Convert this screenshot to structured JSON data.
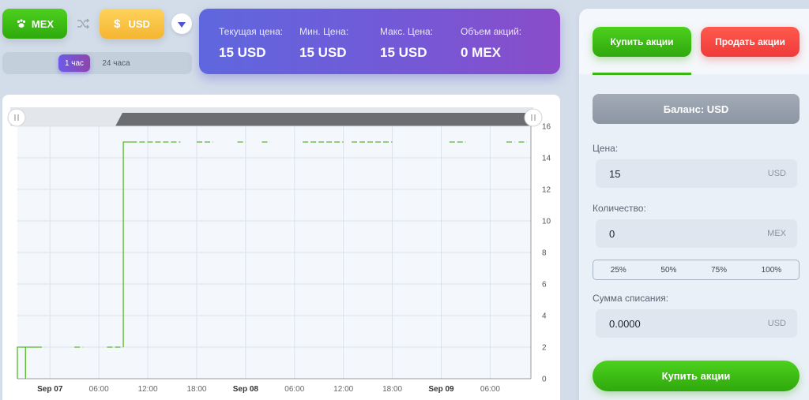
{
  "pair": {
    "base": "MEX",
    "quote": "USD",
    "quote_symbol": "$"
  },
  "periods": [
    {
      "label": "1 час",
      "active": true
    },
    {
      "label": "24 часа",
      "active": false
    }
  ],
  "stats": {
    "current_price_label": "Текущая цена:",
    "current_price_value": "15 USD",
    "min_price_label": "Мин. Цена:",
    "min_price_value": "15 USD",
    "max_price_label": "Макс. Цена:",
    "max_price_value": "15 USD",
    "volume_label": "Объем акций:",
    "volume_value": "0 MEX"
  },
  "tabs": {
    "buy_label": "Купить акции",
    "sell_label": "Продать акции"
  },
  "balance_label": "Баланс: USD",
  "form": {
    "price_label": "Цена:",
    "price_value": "15",
    "price_unit": "USD",
    "qty_label": "Количество:",
    "qty_value": "0",
    "qty_unit": "MEX",
    "percents": [
      "25%",
      "50%",
      "75%",
      "100%"
    ],
    "total_label": "Сумма списания:",
    "total_value": "0.0000",
    "total_unit": "USD",
    "submit_label": "Купить акции"
  },
  "colors": {
    "accent_green": "#3bb615",
    "accent_red": "#f03a3a",
    "stats_gradient_start": "#5f67de",
    "stats_gradient_end": "#8a4cc9",
    "chart_line": "#56b92a"
  },
  "chart_data": {
    "type": "line",
    "title": "",
    "xlabel": "",
    "ylabel": "",
    "x_ticks": [
      "Sep 07",
      "06:00",
      "12:00",
      "18:00",
      "Sep 08",
      "06:00",
      "12:00",
      "18:00",
      "Sep 09",
      "06:00"
    ],
    "y_ticks": [
      0,
      2,
      4,
      6,
      8,
      10,
      12,
      14,
      16
    ],
    "ylim": [
      0,
      16
    ],
    "xlim_hours": [
      -4,
      59
    ],
    "grid": true,
    "series": [
      {
        "segments": [
          {
            "type": "step",
            "points": [
              [
                -4,
                0
              ],
              [
                -4,
                2
              ],
              [
                -3,
                2
              ],
              [
                -3,
                0
              ],
              [
                -3,
                2
              ],
              [
                -1,
                2
              ]
            ]
          },
          {
            "type": "dash",
            "points": [
              [
                3,
                2
              ],
              [
                4,
                2
              ]
            ]
          },
          {
            "type": "dash",
            "points": [
              [
                7,
                2
              ],
              [
                9,
                2
              ]
            ]
          },
          {
            "type": "step",
            "points": [
              [
                9,
                2
              ],
              [
                9,
                15
              ],
              [
                10,
                15
              ]
            ]
          },
          {
            "type": "dash",
            "points": [
              [
                10,
                15
              ],
              [
                16,
                15
              ]
            ]
          },
          {
            "type": "dash",
            "points": [
              [
                18,
                15
              ],
              [
                20,
                15
              ]
            ]
          },
          {
            "type": "dash",
            "points": [
              [
                23,
                15
              ],
              [
                24,
                15
              ]
            ]
          },
          {
            "type": "dash",
            "points": [
              [
                26,
                15
              ],
              [
                27,
                15
              ]
            ]
          },
          {
            "type": "dash",
            "points": [
              [
                31,
                15
              ],
              [
                36,
                15
              ]
            ]
          },
          {
            "type": "dash",
            "points": [
              [
                37,
                15
              ],
              [
                42,
                15
              ]
            ]
          },
          {
            "type": "dash",
            "points": [
              [
                49,
                15
              ],
              [
                51,
                15
              ]
            ]
          },
          {
            "type": "dash",
            "points": [
              [
                56,
                15
              ],
              [
                57,
                15
              ]
            ]
          },
          {
            "type": "dash",
            "points": [
              [
                57.5,
                15
              ],
              [
                58.5,
                15
              ]
            ]
          }
        ]
      }
    ]
  }
}
